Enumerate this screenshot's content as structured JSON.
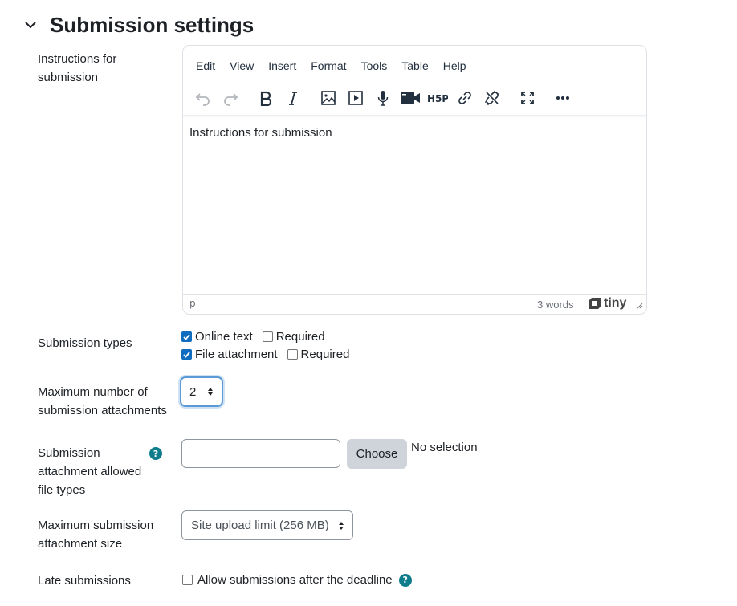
{
  "section": {
    "title": "Submission settings"
  },
  "instructions": {
    "label": "Instructions for submission",
    "editor": {
      "menu": [
        "Edit",
        "View",
        "Insert",
        "Format",
        "Tools",
        "Table",
        "Help"
      ],
      "content": "Instructions for submission",
      "status_path": "p",
      "word_count": "3 words",
      "brand": "tiny"
    }
  },
  "submission_types": {
    "label": "Submission types",
    "online_text": {
      "label": "Online text",
      "checked": true
    },
    "online_text_required": {
      "label": "Required",
      "checked": false
    },
    "file_attachment": {
      "label": "File attachment",
      "checked": true
    },
    "file_attachment_required": {
      "label": "Required",
      "checked": false
    }
  },
  "max_attachments": {
    "label": "Maximum number of submission attachments",
    "value": "2"
  },
  "file_types": {
    "label": "Submission attachment allowed file types",
    "choose_label": "Choose",
    "status": "No selection"
  },
  "max_size": {
    "label": "Maximum submission attachment size",
    "value": "Site upload limit (256 MB)"
  },
  "late": {
    "label": "Late submissions",
    "checkbox_label": "Allow submissions after the deadline",
    "checked": false
  },
  "colors": {
    "accent": "#0f6cbf",
    "help": "#0f7c8c"
  }
}
